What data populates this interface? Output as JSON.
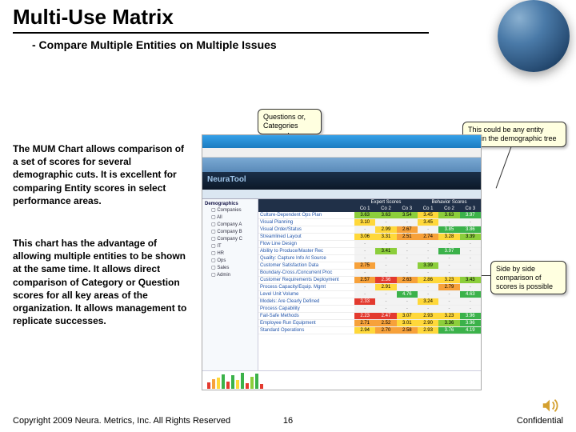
{
  "title": "Multi-Use Matrix",
  "subtitle": "- Compare Multiple Entities on Multiple Issues",
  "para1": "The MUM Chart allows comparison of a set of scores for several demographic cuts.  It is excellent for comparing Entity scores in select performance areas.",
  "para2": "This chart has the advantage of allowing multiple entities to be shown at the same time.  It allows direct comparison of Category or Question scores for all key areas of the organization.  It allows management to replicate successes.",
  "callouts": {
    "c1": "Questions or, Categories",
    "c2": "This could be any entity within the demographic tree",
    "c3": "Side by side comparison of scores is possible"
  },
  "screenshot": {
    "brand": "NeuraTool",
    "tree_header": "Demographics",
    "tree": [
      "Companies",
      "All",
      "Company A",
      "Company B",
      "Company C",
      "IT",
      "HR",
      "Ops",
      "Sales",
      "Admin"
    ],
    "headers": [
      "",
      "Expert Scores",
      "Behavior Scores"
    ],
    "subheaders": [
      "",
      "Co 1",
      "Co 2",
      "Co 3",
      "Co 1",
      "Co 2",
      "Co 3"
    ],
    "rows": [
      {
        "label": "Culture-Dependent Ops Plan",
        "v": [
          "3.63",
          "3.63",
          "3.54",
          "3.45",
          "3.63",
          "3.97"
        ],
        "c": [
          "mh",
          "mh",
          "mh",
          "mid",
          "mh",
          "hi"
        ]
      },
      {
        "label": "Visual Planning",
        "v": [
          "3.10",
          "-",
          "-",
          "3.45",
          "-",
          "-"
        ],
        "c": [
          "mid",
          "na",
          "na",
          "mid",
          "na",
          "na"
        ]
      },
      {
        "label": "Visual Order/Status",
        "v": [
          "-",
          "2.99",
          "2.67",
          "-",
          "3.85",
          "3.86"
        ],
        "c": [
          "na",
          "mid",
          "ml",
          "na",
          "hi",
          "hi"
        ]
      },
      {
        "label": "Streamlined Layout",
        "v": [
          "3.06",
          "3.31",
          "2.51",
          "2.74",
          "3.28",
          "3.39"
        ],
        "c": [
          "mid",
          "mid",
          "ml",
          "ml",
          "mid",
          "mh"
        ]
      },
      {
        "label": "Flow Line Design",
        "v": [
          "-",
          "-",
          "-",
          "-",
          "-",
          "-"
        ],
        "c": [
          "na",
          "na",
          "na",
          "na",
          "na",
          "na"
        ]
      },
      {
        "label": "Ability to Produce/Master Rec",
        "v": [
          "-",
          "3.41",
          "-",
          "-",
          "3.97",
          "-"
        ],
        "c": [
          "na",
          "mh",
          "na",
          "na",
          "hi",
          "na"
        ]
      },
      {
        "label": "Quality: Capture Info At Source",
        "v": [
          "-",
          "-",
          "-",
          "-",
          "-",
          "-"
        ],
        "c": [
          "na",
          "na",
          "na",
          "na",
          "na",
          "na"
        ]
      },
      {
        "label": "Customer Satisfaction Data",
        "v": [
          "2.75",
          "-",
          "-",
          "3.39",
          "-",
          "-"
        ],
        "c": [
          "ml",
          "na",
          "na",
          "mh",
          "na",
          "na"
        ]
      },
      {
        "label": "Boundary-Cross./Concurrent Proc",
        "v": [
          "-",
          "-",
          "-",
          "-",
          "-",
          "-"
        ],
        "c": [
          "na",
          "na",
          "na",
          "na",
          "na",
          "na"
        ]
      },
      {
        "label": "Customer Requirements Deployment",
        "v": [
          "2.57",
          "2.36",
          "2.63",
          "2.86",
          "3.23",
          "3.43"
        ],
        "c": [
          "ml",
          "lo",
          "ml",
          "mid",
          "mid",
          "mh"
        ]
      },
      {
        "label": "Process Capacity/Equip. Mgmt",
        "v": [
          "-",
          "2.91",
          "-",
          "-",
          "2.79",
          "-"
        ],
        "c": [
          "na",
          "mid",
          "na",
          "na",
          "ml",
          "na"
        ]
      },
      {
        "label": "Level Unit Volume",
        "v": [
          "-",
          "-",
          "4.76",
          "-",
          "-",
          "4.63"
        ],
        "c": [
          "na",
          "na",
          "hi",
          "na",
          "na",
          "hi"
        ]
      },
      {
        "label": "Models: Are Clearly Defined",
        "v": [
          "2.33",
          "-",
          "-",
          "3.24",
          "-",
          "-"
        ],
        "c": [
          "lo",
          "na",
          "na",
          "mid",
          "na",
          "na"
        ]
      },
      {
        "label": "Process Capability",
        "v": [
          "-",
          "-",
          "-",
          "-",
          "-",
          "-"
        ],
        "c": [
          "na",
          "na",
          "na",
          "na",
          "na",
          "na"
        ]
      },
      {
        "label": "Fail-Safe Methods",
        "v": [
          "2.23",
          "2.47",
          "3.07",
          "2.93",
          "3.23",
          "3.96"
        ],
        "c": [
          "lo",
          "lo",
          "mid",
          "mid",
          "mid",
          "hi"
        ]
      },
      {
        "label": "Employee Run Equipment",
        "v": [
          "2.71",
          "2.52",
          "3.01",
          "2.90",
          "3.36",
          "3.96"
        ],
        "c": [
          "ml",
          "ml",
          "mid",
          "mid",
          "mh",
          "hi"
        ]
      },
      {
        "label": "Standard Operations",
        "v": [
          "2.94",
          "2.70",
          "2.58",
          "2.93",
          "3.76",
          "4.19"
        ],
        "c": [
          "mid",
          "ml",
          "ml",
          "mid",
          "hi",
          "hi"
        ]
      }
    ],
    "chart_bars": [
      {
        "h": 8,
        "c": "lo"
      },
      {
        "h": 12,
        "c": "ml"
      },
      {
        "h": 14,
        "c": "mid"
      },
      {
        "h": 18,
        "c": "hi"
      },
      {
        "h": 9,
        "c": "lo"
      },
      {
        "h": 17,
        "c": "hi"
      },
      {
        "h": 11,
        "c": "mid"
      },
      {
        "h": 20,
        "c": "hi"
      },
      {
        "h": 7,
        "c": "lo"
      },
      {
        "h": 15,
        "c": "mh"
      },
      {
        "h": 19,
        "c": "hi"
      },
      {
        "h": 6,
        "c": "lo"
      }
    ]
  },
  "footer": {
    "copyright": "Copyright 2009 Neura. Metrics, Inc.  All Rights Reserved",
    "page": "16",
    "confidential": "Confidential"
  }
}
